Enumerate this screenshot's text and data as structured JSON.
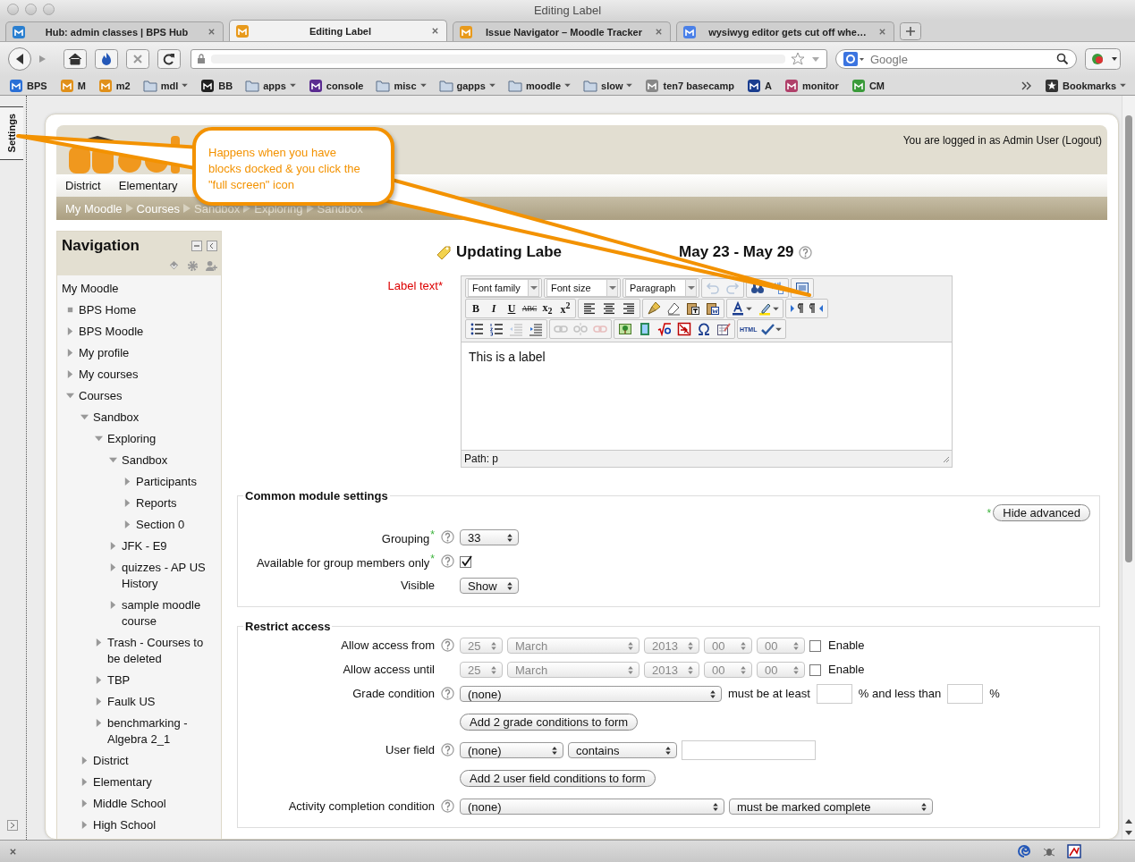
{
  "window": {
    "title": "Editing Label"
  },
  "tabs": [
    {
      "label": "Hub: admin classes | BPS Hub",
      "selected": false
    },
    {
      "label": "Editing Label",
      "selected": true
    },
    {
      "label": "Issue Navigator – Moodle Tracker",
      "selected": false
    },
    {
      "label": "wysiwyg editor gets cut off whe…",
      "selected": false
    }
  ],
  "search": {
    "placeholder": "Google"
  },
  "bookmarks": [
    {
      "label": "BPS",
      "kind": "link"
    },
    {
      "label": "M",
      "kind": "link"
    },
    {
      "label": "m2",
      "kind": "link"
    },
    {
      "label": "mdl",
      "kind": "folder"
    },
    {
      "label": "BB",
      "kind": "link"
    },
    {
      "label": "apps",
      "kind": "folder"
    },
    {
      "label": "console",
      "kind": "link"
    },
    {
      "label": "misc",
      "kind": "folder"
    },
    {
      "label": "gapps",
      "kind": "folder"
    },
    {
      "label": "moodle",
      "kind": "folder"
    },
    {
      "label": "slow",
      "kind": "folder"
    },
    {
      "label": "ten7 basecamp",
      "kind": "link"
    },
    {
      "label": "A",
      "kind": "link"
    },
    {
      "label": "monitor",
      "kind": "link"
    },
    {
      "label": "CM",
      "kind": "link"
    }
  ],
  "bookmarks_menu": "Bookmarks",
  "dock": {
    "label": "Settings"
  },
  "callout": "Happens when you have blocks docked & you click the \"full screen\" icon",
  "site": {
    "login": "You are logged in as Admin User (Logout)",
    "menu": [
      "District",
      "Elementary"
    ],
    "breadcrumbs": [
      "My Moodle",
      "Courses",
      "Sandbox",
      "Exploring",
      "Sandbox"
    ]
  },
  "navigation": {
    "title": "Navigation",
    "items": [
      {
        "label": "My Moodle",
        "kind": "root",
        "children": [
          {
            "label": "BPS Home",
            "kind": "leaf"
          },
          {
            "label": "BPS Moodle",
            "kind": "branch",
            "expanded": false
          },
          {
            "label": "My profile",
            "kind": "branch",
            "expanded": false
          },
          {
            "label": "My courses",
            "kind": "branch",
            "expanded": false
          },
          {
            "label": "Courses",
            "kind": "branch",
            "expanded": true,
            "children": [
              {
                "label": "Sandbox",
                "kind": "branch",
                "expanded": true,
                "children": [
                  {
                    "label": "Exploring",
                    "kind": "branch",
                    "expanded": true,
                    "children": [
                      {
                        "label": "Sandbox",
                        "kind": "branch",
                        "expanded": true,
                        "children": [
                          {
                            "label": "Participants",
                            "kind": "branch",
                            "expanded": false
                          },
                          {
                            "label": "Reports",
                            "kind": "branch",
                            "expanded": false
                          },
                          {
                            "label": "Section 0",
                            "kind": "branch",
                            "expanded": false
                          }
                        ]
                      },
                      {
                        "label": "JFK - E9",
                        "kind": "branch",
                        "expanded": false
                      },
                      {
                        "label": "quizzes - AP US History",
                        "kind": "branch",
                        "expanded": false
                      },
                      {
                        "label": "sample moodle course",
                        "kind": "branch",
                        "expanded": false
                      }
                    ]
                  },
                  {
                    "label": "Trash - Courses to be deleted",
                    "kind": "branch",
                    "expanded": false
                  },
                  {
                    "label": "TBP",
                    "kind": "branch",
                    "expanded": false
                  },
                  {
                    "label": "Faulk US",
                    "kind": "branch",
                    "expanded": false
                  },
                  {
                    "label": "benchmarking - Algebra 2_1",
                    "kind": "branch",
                    "expanded": false
                  }
                ]
              },
              {
                "label": "District",
                "kind": "branch",
                "expanded": false
              },
              {
                "label": "Elementary",
                "kind": "branch",
                "expanded": false
              },
              {
                "label": "Middle School",
                "kind": "branch",
                "expanded": false
              },
              {
                "label": "High School",
                "kind": "branch",
                "expanded": false
              }
            ]
          }
        ]
      }
    ]
  },
  "heading": [
    "Updating Labe",
    "May 23 - May 29"
  ],
  "editor": {
    "label": "Label text",
    "mark": "*",
    "content": "This is a label",
    "path": "Path: p",
    "toolbar": [
      [
        [
          {
            "kind": "select",
            "label": "Font family"
          }
        ],
        [
          {
            "kind": "select",
            "label": "Font size"
          }
        ],
        [
          {
            "kind": "select",
            "label": "Paragraph"
          }
        ],
        [
          {
            "kind": "icon",
            "disabled": true
          },
          {
            "kind": "icon",
            "disabled": true
          }
        ],
        [
          {
            "kind": "icon",
            "disabled": false
          },
          {
            "kind": "icon",
            "disabled": false
          }
        ],
        [
          {
            "kind": "icon",
            "disabled": false
          }
        ]
      ],
      [
        [
          {
            "kind": "bold",
            "label": "B"
          },
          {
            "kind": "italic",
            "label": "I"
          },
          {
            "kind": "underline",
            "label": "U"
          },
          {
            "kind": "strike",
            "label": "ABC"
          },
          {
            "kind": "script",
            "label": "x$_{2}$"
          },
          {
            "kind": "script",
            "label": "x$^{2}$"
          }
        ],
        [
          {
            "kind": "icon",
            "disabled": false
          },
          {
            "kind": "icon",
            "disabled": false
          },
          {
            "kind": "icon",
            "disabled": false
          }
        ],
        [
          {
            "kind": "icon",
            "disabled": false
          },
          {
            "kind": "icon",
            "disabled": false
          },
          {
            "kind": "icon",
            "disabled": false
          },
          {
            "kind": "icon",
            "disabled": false
          }
        ],
        [
          {
            "kind": "split",
            "disabled": false
          },
          {
            "kind": "split",
            "disabled": false
          }
        ],
        [
          {
            "kind": "icon",
            "disabled": false
          },
          {
            "kind": "icon",
            "disabled": false
          }
        ]
      ],
      [
        [
          {
            "kind": "icon",
            "disabled": false
          },
          {
            "kind": "icon",
            "disabled": false
          },
          {
            "kind": "icon",
            "disabled": true
          },
          {
            "kind": "icon",
            "disabled": false
          }
        ],
        [
          {
            "kind": "icon",
            "disabled": true
          },
          {
            "kind": "icon",
            "disabled": true
          },
          {
            "kind": "icon",
            "disabled": true
          }
        ],
        [
          {
            "kind": "icon",
            "disabled": false
          },
          {
            "kind": "icon",
            "disabled": false
          },
          {
            "kind": "icon",
            "disabled": false
          },
          {
            "kind": "icon",
            "disabled": false
          },
          {
            "kind": "icon",
            "disabled": false
          },
          {
            "kind": "icon",
            "disabled": false
          }
        ],
        [
          {
            "kind": "html",
            "label": "HTML"
          },
          {
            "kind": "split",
            "disabled": false
          }
        ]
      ]
    ]
  },
  "common": {
    "title": "Common module settings",
    "advanced_mark": "*",
    "advanced_button": "Hide advanced",
    "fields": [
      {
        "kind": "select",
        "label": "Grouping",
        "mark": "*",
        "help": true,
        "value": "33"
      },
      {
        "kind": "checkbox",
        "label": "Available for group members only",
        "mark": "*",
        "help": true,
        "checked": true
      },
      {
        "kind": "select",
        "label": "Visible",
        "help": false,
        "value": "Show"
      }
    ]
  },
  "restrict": {
    "title": "Restrict access",
    "rows": [
      {
        "kind": "date",
        "label": "Allow access from",
        "help": true,
        "disabled": true,
        "parts": [
          "25",
          "March",
          "2013",
          "00",
          "00"
        ],
        "enable": {
          "label": "Enable",
          "checked": false
        }
      },
      {
        "kind": "date",
        "label": "Allow access until",
        "help": false,
        "disabled": true,
        "parts": [
          "25",
          "March",
          "2013",
          "00",
          "00"
        ],
        "enable": {
          "label": "Enable",
          "checked": false
        }
      },
      {
        "kind": "grade",
        "label": "Grade condition",
        "help": true,
        "value": "(none)",
        "min_label": "must be at least",
        "max_label": "% and less than",
        "unit": "%"
      },
      {
        "kind": "button",
        "label": "Add 2 grade conditions to form"
      },
      {
        "kind": "userfield",
        "label": "User field",
        "help": true,
        "value": "(none)",
        "operator": "contains"
      },
      {
        "kind": "button",
        "label": "Add 2 user field conditions to form"
      },
      {
        "kind": "completion",
        "label": "Activity completion condition",
        "help": true,
        "value": "(none)",
        "state": "must be marked complete"
      }
    ]
  }
}
